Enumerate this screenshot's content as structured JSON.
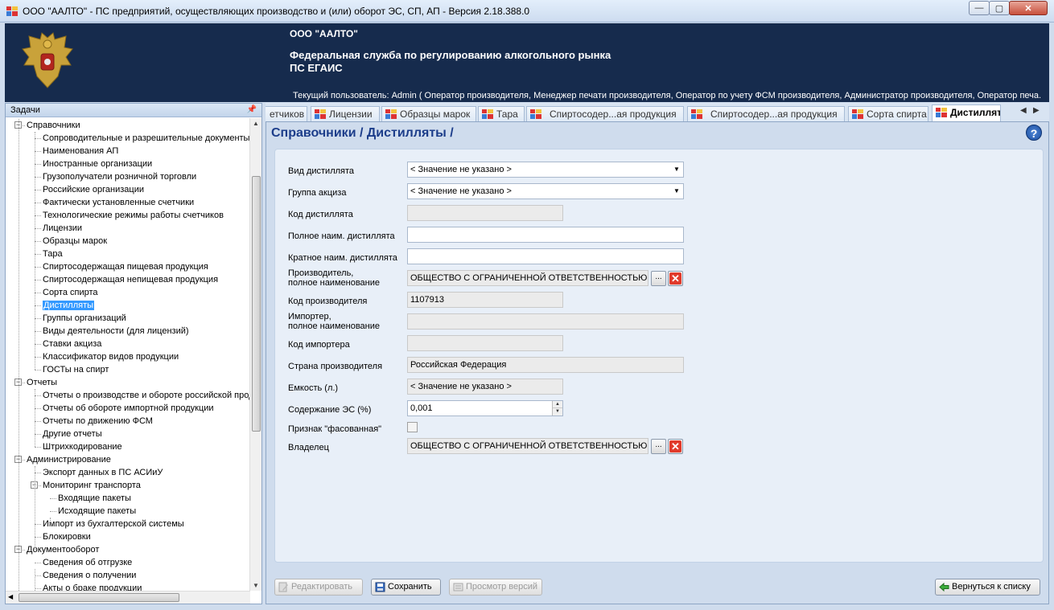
{
  "window": {
    "title": "ООО \"ААЛТО\" - ПС предприятий, осуществляющих производство и (или) оборот ЭС, СП, АП - Версия 2.18.388.0",
    "minimize": "—",
    "maximize": "▢",
    "close": "✕"
  },
  "banner": {
    "org": "ООО \"ААЛТО\"",
    "agency_line1": "Федеральная служба по регулированию алкогольного рынка",
    "agency_line2": "ПС ЕГАИС",
    "user": "Текущий пользователь: Admin ( Оператор производителя, Менеджер печати производителя, Оператор по учету ФСМ производителя, Администратор производителя, Оператор печа..."
  },
  "tasks": {
    "title": "Задачи",
    "items": [
      {
        "label": "Справочники",
        "expander": "−"
      },
      {
        "label": "Сопроводительные и разрешительные документы"
      },
      {
        "label": "Наименования АП"
      },
      {
        "label": "Иностранные организации"
      },
      {
        "label": "Грузополучатели розничной торговли"
      },
      {
        "label": "Российские организации"
      },
      {
        "label": "Фактически установленные счетчики"
      },
      {
        "label": "Технологические режимы работы счетчиков"
      },
      {
        "label": "Лицензии"
      },
      {
        "label": "Образцы марок"
      },
      {
        "label": "Тара"
      },
      {
        "label": "Спиртосодержащая пищевая продукция"
      },
      {
        "label": "Спиртосодержащая непищевая продукция"
      },
      {
        "label": "Сорта спирта"
      },
      {
        "label": "Дистилляты"
      },
      {
        "label": "Группы организаций"
      },
      {
        "label": "Виды деятельности (для лицензий)"
      },
      {
        "label": "Ставки акциза"
      },
      {
        "label": "Классификатор видов продукции"
      },
      {
        "label": "ГОСТы на спирт"
      },
      {
        "label": "Отчеты",
        "expander": "−"
      },
      {
        "label": "Отчеты о производстве и обороте российской прод"
      },
      {
        "label": "Отчеты об обороте импортной продукции"
      },
      {
        "label": "Отчеты по движению ФСМ"
      },
      {
        "label": "Другие отчеты"
      },
      {
        "label": "Штрихкодирование"
      },
      {
        "label": "Администрирование",
        "expander": "−"
      },
      {
        "label": "Экспорт данных в ПС АСИиУ"
      },
      {
        "label": "Мониторинг транспорта",
        "expander": "−"
      },
      {
        "label": "Входящие пакеты"
      },
      {
        "label": "Исходящие пакеты"
      },
      {
        "label": "Импорт из бухгалтерской системы"
      },
      {
        "label": "Блокировки"
      },
      {
        "label": "Документооборот",
        "expander": "−"
      },
      {
        "label": "Сведения об отгрузке"
      },
      {
        "label": "Сведения о получении"
      },
      {
        "label": "Акты о браке продукции"
      }
    ]
  },
  "tabs": [
    {
      "label": "етчиков"
    },
    {
      "label": "Лицензии"
    },
    {
      "label": "Образцы марок"
    },
    {
      "label": "Тара"
    },
    {
      "label": "Спиртосодер...ая продукция"
    },
    {
      "label": "Спиртосодер...ая продукция"
    },
    {
      "label": "Сорта спирта"
    },
    {
      "label": "Дистилляты"
    }
  ],
  "tab_nav": {
    "prev": "◀",
    "next": "▶"
  },
  "page": {
    "title": "Справочники / Дистилляты /",
    "help": "?"
  },
  "form": {
    "vid_label": "Вид дистиллята",
    "vid_value": "< Значение не указано >",
    "gruppa_label": "Группа акциза",
    "gruppa_value": "< Значение не указано >",
    "kod_label": "Код дистиллята",
    "kod_value": "",
    "full_label": "Полное наим. дистиллята",
    "full_value": "",
    "short_label": "Кратное наим. дистиллята",
    "short_value": "",
    "producer_label1": "Производитель,",
    "producer_label2": "полное наименование",
    "producer_value": "ОБЩЕСТВО С ОГРАНИЧЕННОЙ ОТВЕТСТВЕННОСТЬЮ \"ААЛТО\"",
    "producer_code_label": "Код производителя",
    "producer_code_value": "1107913",
    "importer_label1": "Импортер,",
    "importer_label2": "полное наименование",
    "importer_value": "",
    "importer_code_label": "Код импортера",
    "importer_code_value": "",
    "country_label": "Страна производителя",
    "country_value": "Российская Федерация",
    "capacity_label": "Емкость (л.)",
    "capacity_value": "< Значение не указано >",
    "es_label": "Содержание ЭС (%)",
    "es_value": "0,001",
    "packed_label": "Признак \"фасованная\"",
    "owner_label": "Владелец",
    "owner_value": "ОБЩЕСТВО С ОГРАНИЧЕННОЙ ОТВЕТСТВЕННОСТЬЮ \"ААЛТО\"",
    "browse": "...",
    "clear": "✕"
  },
  "buttons": {
    "edit": "Редактировать",
    "save": "Сохранить",
    "versions": "Просмотр версий",
    "back": "Вернуться к списку"
  }
}
